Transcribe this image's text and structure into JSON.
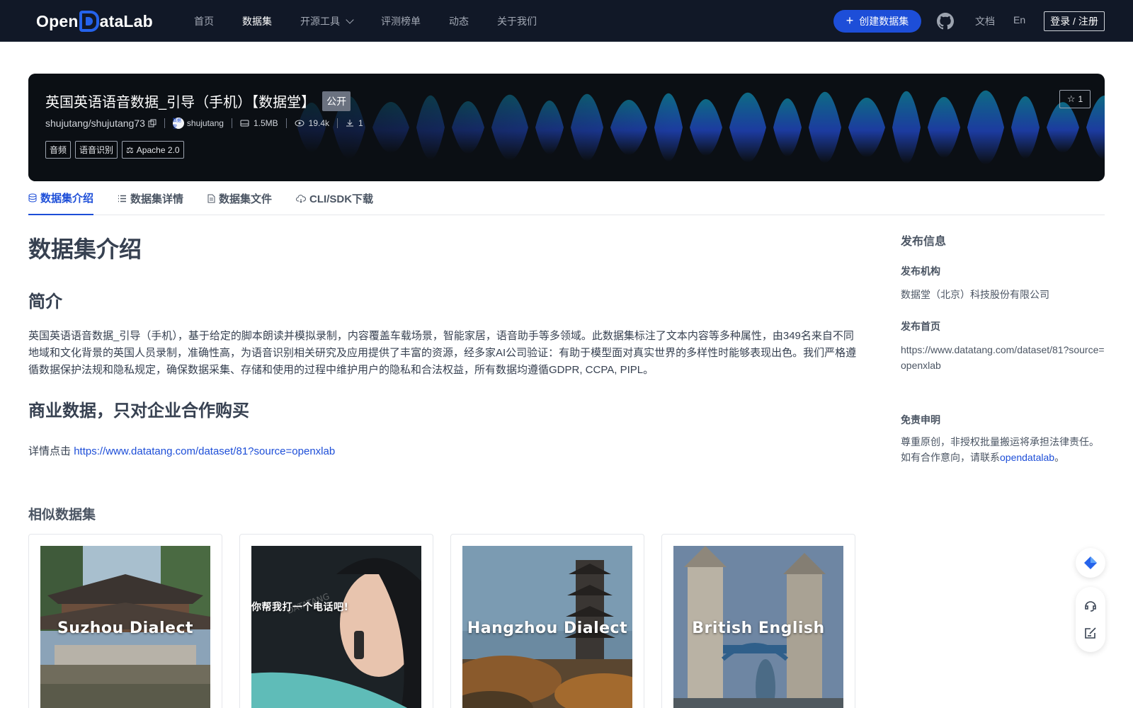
{
  "nav": {
    "logo": "OpenDataLab",
    "logo_pre": "Open",
    "logo_post": "ataLab",
    "links": [
      "首页",
      "数据集",
      "开源工具",
      "评测榜单",
      "动态",
      "关于我们"
    ],
    "active": "数据集",
    "create_label": "创建数据集",
    "docs": "文档",
    "lang": "En",
    "login": "登录 / 注册"
  },
  "dataset": {
    "title": "英国英语语音数据_引导（手机）【数据堂】",
    "visibility": "公开",
    "repo": "shujutang/shujutang73",
    "owner": "shujutang",
    "owner_avatar": "数据堂",
    "size": "1.5MB",
    "views": "19.4k",
    "downloads": "1",
    "tags": [
      "音频",
      "语音识别"
    ],
    "license": "Apache 2.0",
    "stars": "1"
  },
  "tabs": [
    "数据集介绍",
    "数据集详情",
    "数据集文件",
    "CLI/SDK下载"
  ],
  "content": {
    "heading": "数据集介绍",
    "intro_heading": "简介",
    "intro_text": "英国英语语音数据_引导（手机），基于给定的脚本朗读并模拟录制，内容覆盖车载场景，智能家居，语音助手等多领域。此数据集标注了文本内容等多种属性，由349名来自不同地域和文化背景的英国人员录制，准确性高，为语音识别相关研究及应用提供了丰富的资源，经多家AI公司验证：有助于模型面对真实世界的多样性时能够表现出色。我们严格遵循数据保护法规和隐私规定，确保数据采集、存储和使用的过程中维护用户的隐私和合法权益，所有数据均遵循GDPR, CCPA, PIPL。",
    "commercial_heading": "商业数据，只对企业合作购买",
    "detail_prefix": "详情点击",
    "detail_link": "https://www.datatang.com/dataset/81?source=openxlab"
  },
  "similar": {
    "title": "相似数据集",
    "cards": [
      {
        "caption": "Suzhou Dialect"
      },
      {
        "caption": "你帮我打一个电话吧!"
      },
      {
        "caption": "Hangzhou Dialect"
      },
      {
        "caption": "British English"
      }
    ],
    "watermark": "DATATANG"
  },
  "sidebar": {
    "title": "发布信息",
    "org_label": "发布机构",
    "org": "数据堂（北京）科技股份有限公司",
    "home_label": "发布首页",
    "home_link": "https://www.datatang.com/dataset/81?source=openxlab",
    "disclaimer_label": "免责申明",
    "disclaimer_text": "尊重原创，非授权批量搬运将承担法律责任。如有合作意向，请联系",
    "disclaimer_link": "opendatalab",
    "disclaimer_end": "。"
  },
  "colors": {
    "brand": "#1d4ed8",
    "nav_bg": "#111827"
  }
}
